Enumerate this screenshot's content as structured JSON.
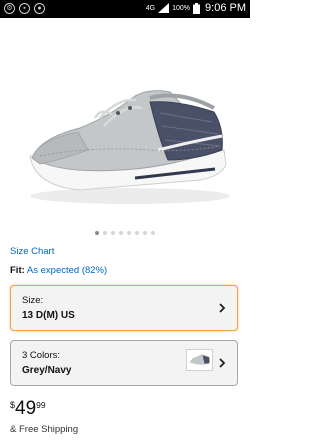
{
  "status_bar": {
    "network": "4G",
    "battery": "100%",
    "time": "9:06 PM",
    "icons": [
      "settings-icon",
      "image-icon",
      "location-icon"
    ]
  },
  "product": {
    "image_description_icon": "boat-shoe-image",
    "carousel": {
      "total": 8,
      "active_index": 0
    },
    "size_chart_link": "Size Chart",
    "fit": {
      "label": "Fit:",
      "value": "As expected (82%)"
    },
    "size_option": {
      "label": "Size:",
      "value": "13 D(M) US"
    },
    "color_option": {
      "label": "3 Colors:",
      "value": "Grey/Navy"
    },
    "price": {
      "currency": "$",
      "whole": "49",
      "fraction": "99"
    },
    "shipping": "& Free Shipping"
  },
  "colors": {
    "link": "#0066c0",
    "highlight_border": "#f0a040"
  }
}
